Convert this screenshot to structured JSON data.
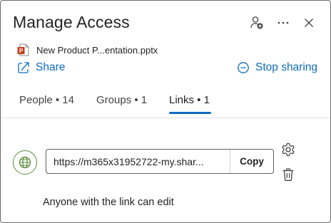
{
  "header": {
    "title": "Manage Access"
  },
  "file": {
    "name": "New Product P...entation.pptx",
    "icon": "powerpoint-file-icon"
  },
  "actions": {
    "share_label": "Share",
    "stop_sharing_label": "Stop sharing"
  },
  "tabs": [
    {
      "label": "People • 14",
      "active": false
    },
    {
      "label": "Groups • 1",
      "active": false
    },
    {
      "label": "Links • 1",
      "active": true
    }
  ],
  "link": {
    "url": "https://m365x31952722-my.shar...",
    "copy_label": "Copy",
    "permission": "Anyone with the link can edit",
    "icon": "globe-icon"
  },
  "colors": {
    "accent": "#0f6cbd",
    "globe": "#5a8a3a",
    "powerpoint": "#c43e1c"
  }
}
